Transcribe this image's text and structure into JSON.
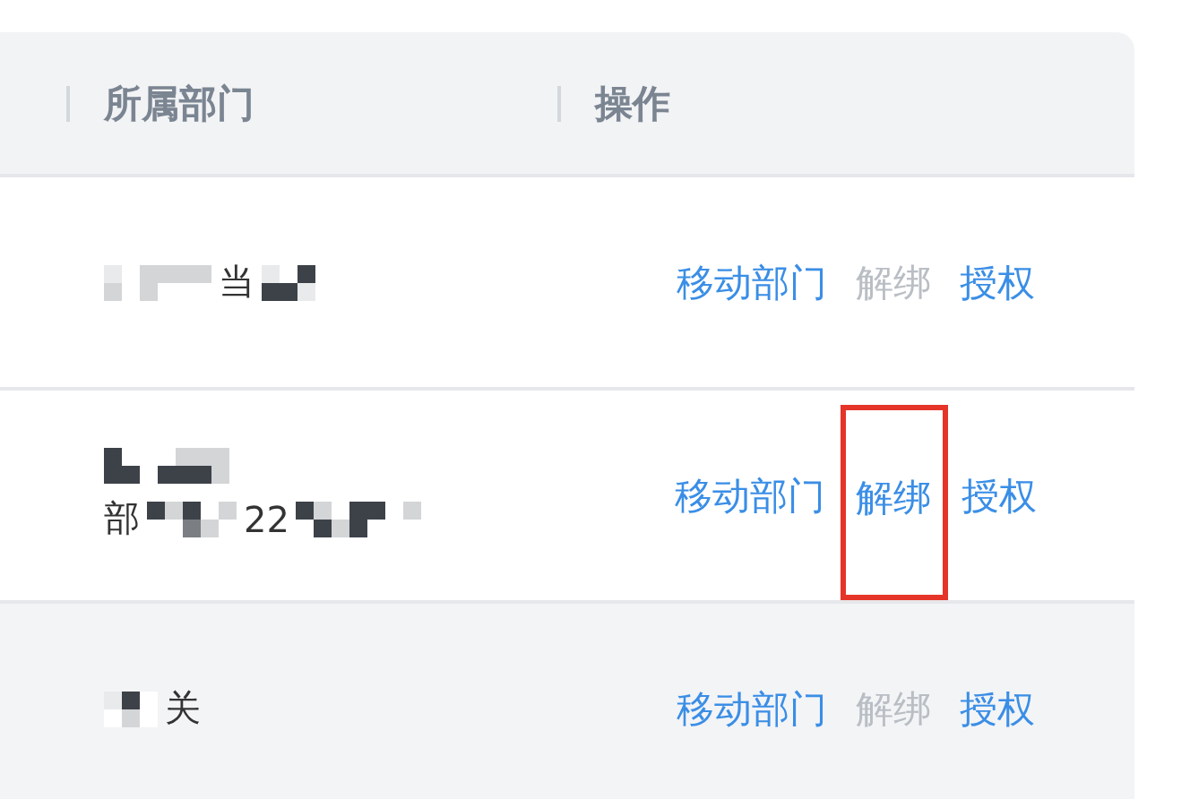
{
  "table": {
    "columns": [
      {
        "label": "所属部门"
      },
      {
        "label": "操作"
      }
    ],
    "rows": [
      {
        "department": {
          "lines": [
            [
              {
                "kind": "mosaic"
              },
              {
                "kind": "text",
                "text": "当"
              },
              {
                "kind": "mosaic"
              }
            ]
          ]
        },
        "actions": [
          {
            "label": "移动部门",
            "disabled": false,
            "highlighted": false
          },
          {
            "label": "解绑",
            "disabled": true,
            "highlighted": false
          },
          {
            "label": "授权",
            "disabled": false,
            "highlighted": false
          }
        ],
        "selected": false
      },
      {
        "department": {
          "lines": [
            [
              {
                "kind": "mosaic"
              }
            ],
            [
              {
                "kind": "text",
                "text": "部"
              },
              {
                "kind": "mosaic"
              },
              {
                "kind": "text",
                "text": "22"
              },
              {
                "kind": "mosaic"
              }
            ]
          ]
        },
        "actions": [
          {
            "label": "移动部门",
            "disabled": false,
            "highlighted": false
          },
          {
            "label": "解绑",
            "disabled": false,
            "highlighted": true
          },
          {
            "label": "授权",
            "disabled": false,
            "highlighted": false
          }
        ],
        "selected": false
      },
      {
        "department": {
          "lines": [
            [
              {
                "kind": "mosaic"
              },
              {
                "kind": "text",
                "text": "关"
              }
            ]
          ]
        },
        "actions": [
          {
            "label": "移动部门",
            "disabled": false,
            "highlighted": false
          },
          {
            "label": "解绑",
            "disabled": true,
            "highlighted": false
          },
          {
            "label": "授权",
            "disabled": false,
            "highlighted": false
          }
        ],
        "selected": true
      }
    ]
  }
}
